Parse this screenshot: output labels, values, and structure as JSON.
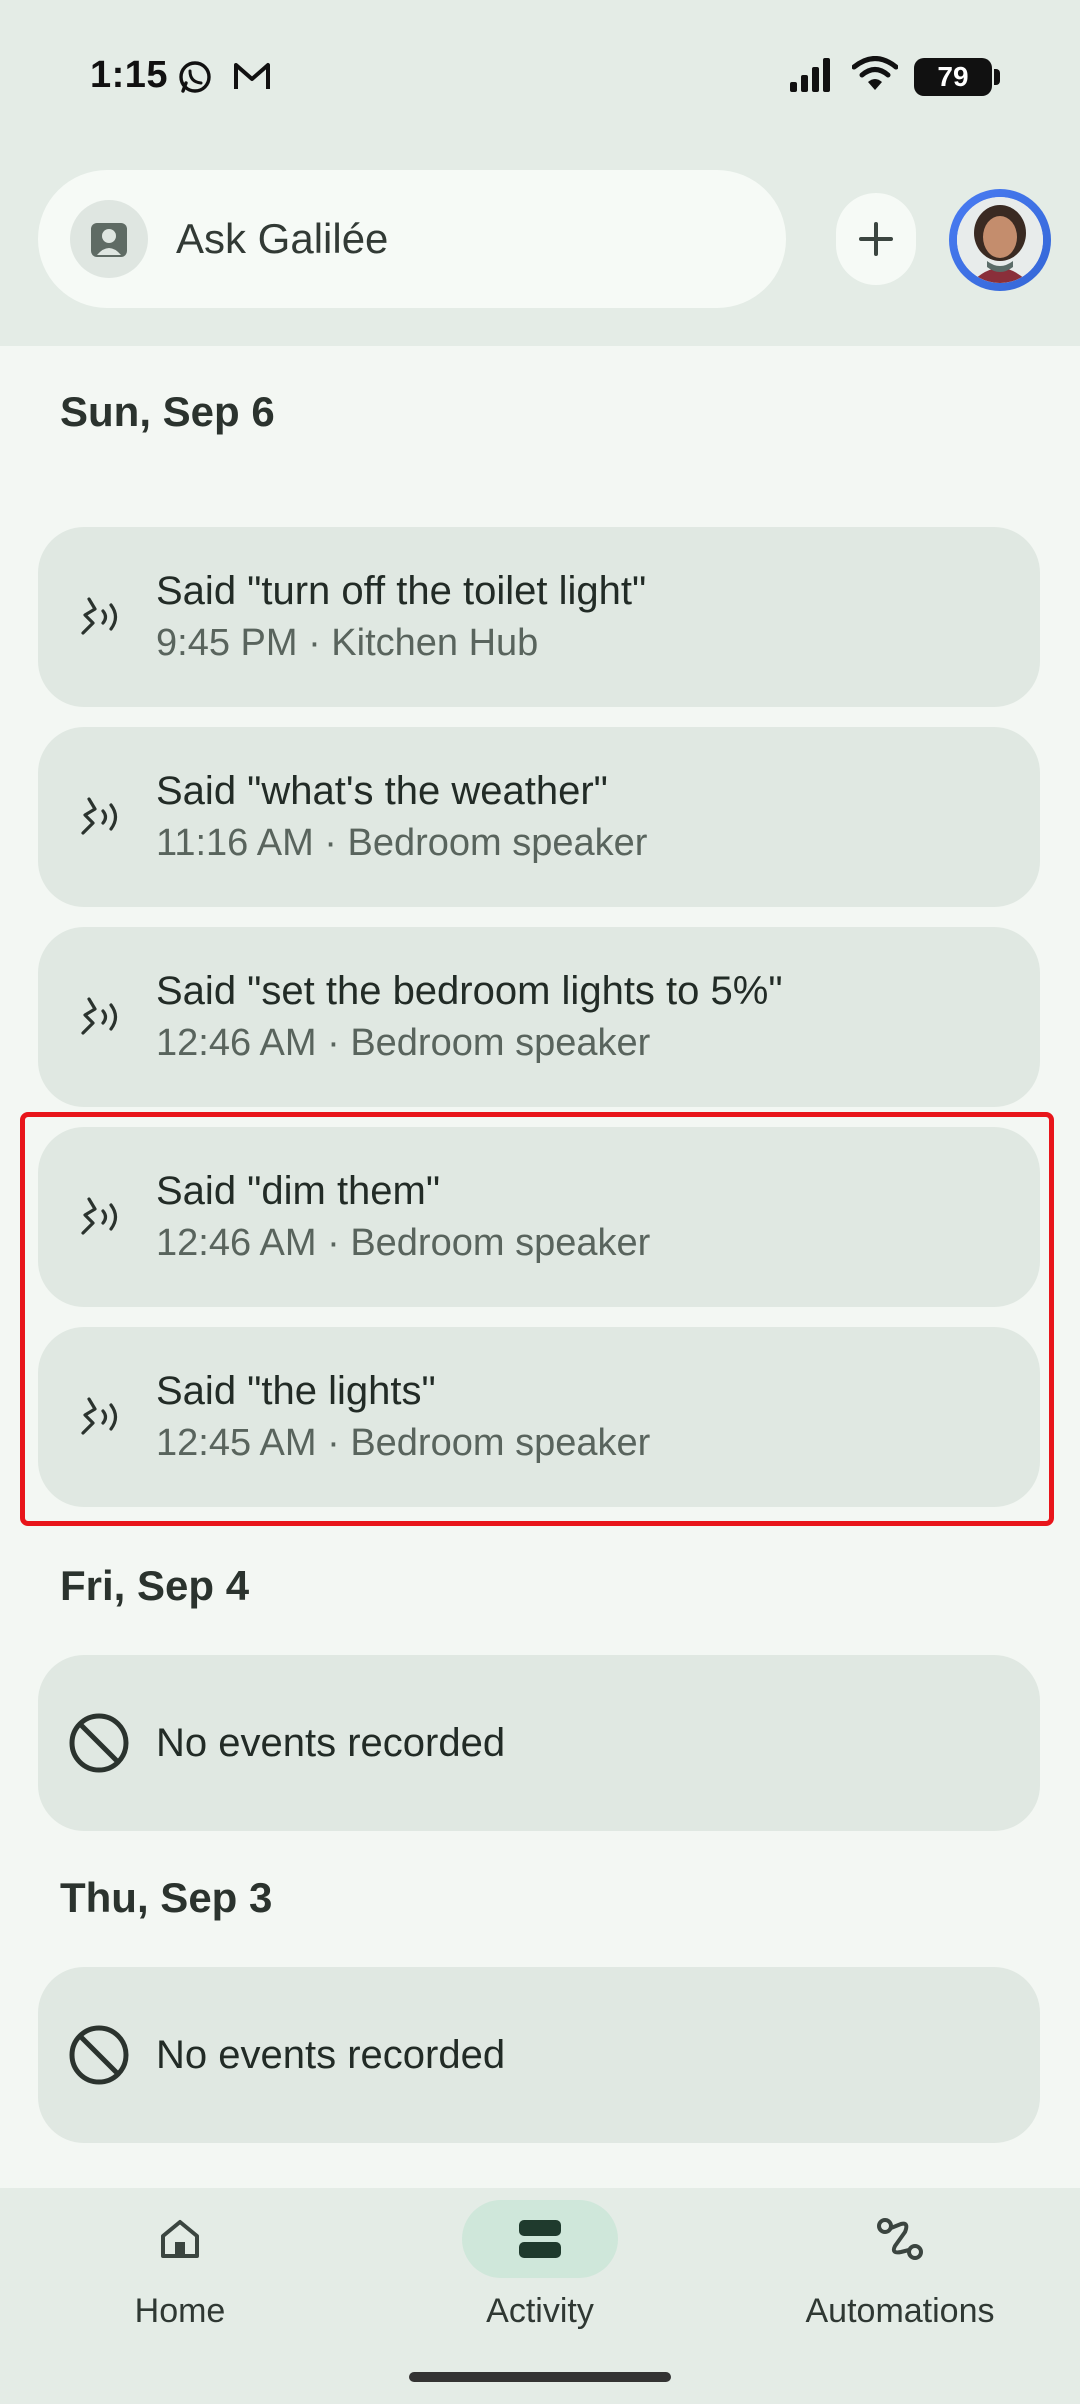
{
  "status_bar": {
    "time": "1:15",
    "battery": "79",
    "icons": [
      "whatsapp-icon",
      "gmail-icon",
      "signal-icon",
      "wifi-icon",
      "battery-icon"
    ]
  },
  "search": {
    "placeholder": "Ask Galilée"
  },
  "sections": [
    {
      "date": "Sun, Sep 6",
      "events": [
        {
          "title": "Said \"turn off the toilet light\"",
          "subtitle": "9:45 PM · Kitchen Hub"
        },
        {
          "title": "Said \"what's the weather\"",
          "subtitle": "11:16 AM · Bedroom speaker"
        },
        {
          "title": "Said \"set the bedroom lights to 5%\"",
          "subtitle": "12:46 AM · Bedroom speaker"
        },
        {
          "title": "Said \"dim them\"",
          "subtitle": "12:46 AM · Bedroom speaker"
        },
        {
          "title": "Said \"the lights\"",
          "subtitle": "12:45 AM · Bedroom speaker"
        }
      ]
    },
    {
      "date": "Fri, Sep 4",
      "empty_text": "No events recorded"
    },
    {
      "date": "Thu, Sep 3",
      "empty_text": "No events recorded"
    }
  ],
  "nav": {
    "items": [
      {
        "label": "Home",
        "icon": "home-icon",
        "active": false
      },
      {
        "label": "Activity",
        "icon": "activity-icon",
        "active": true
      },
      {
        "label": "Automations",
        "icon": "automations-icon",
        "active": false
      }
    ]
  },
  "colors": {
    "background": "#f3f7f3",
    "card": "#e0e8e2",
    "active_nav": "#cfe7da",
    "highlight": "#e8151a",
    "profile_ring": "#4a7cf3"
  }
}
